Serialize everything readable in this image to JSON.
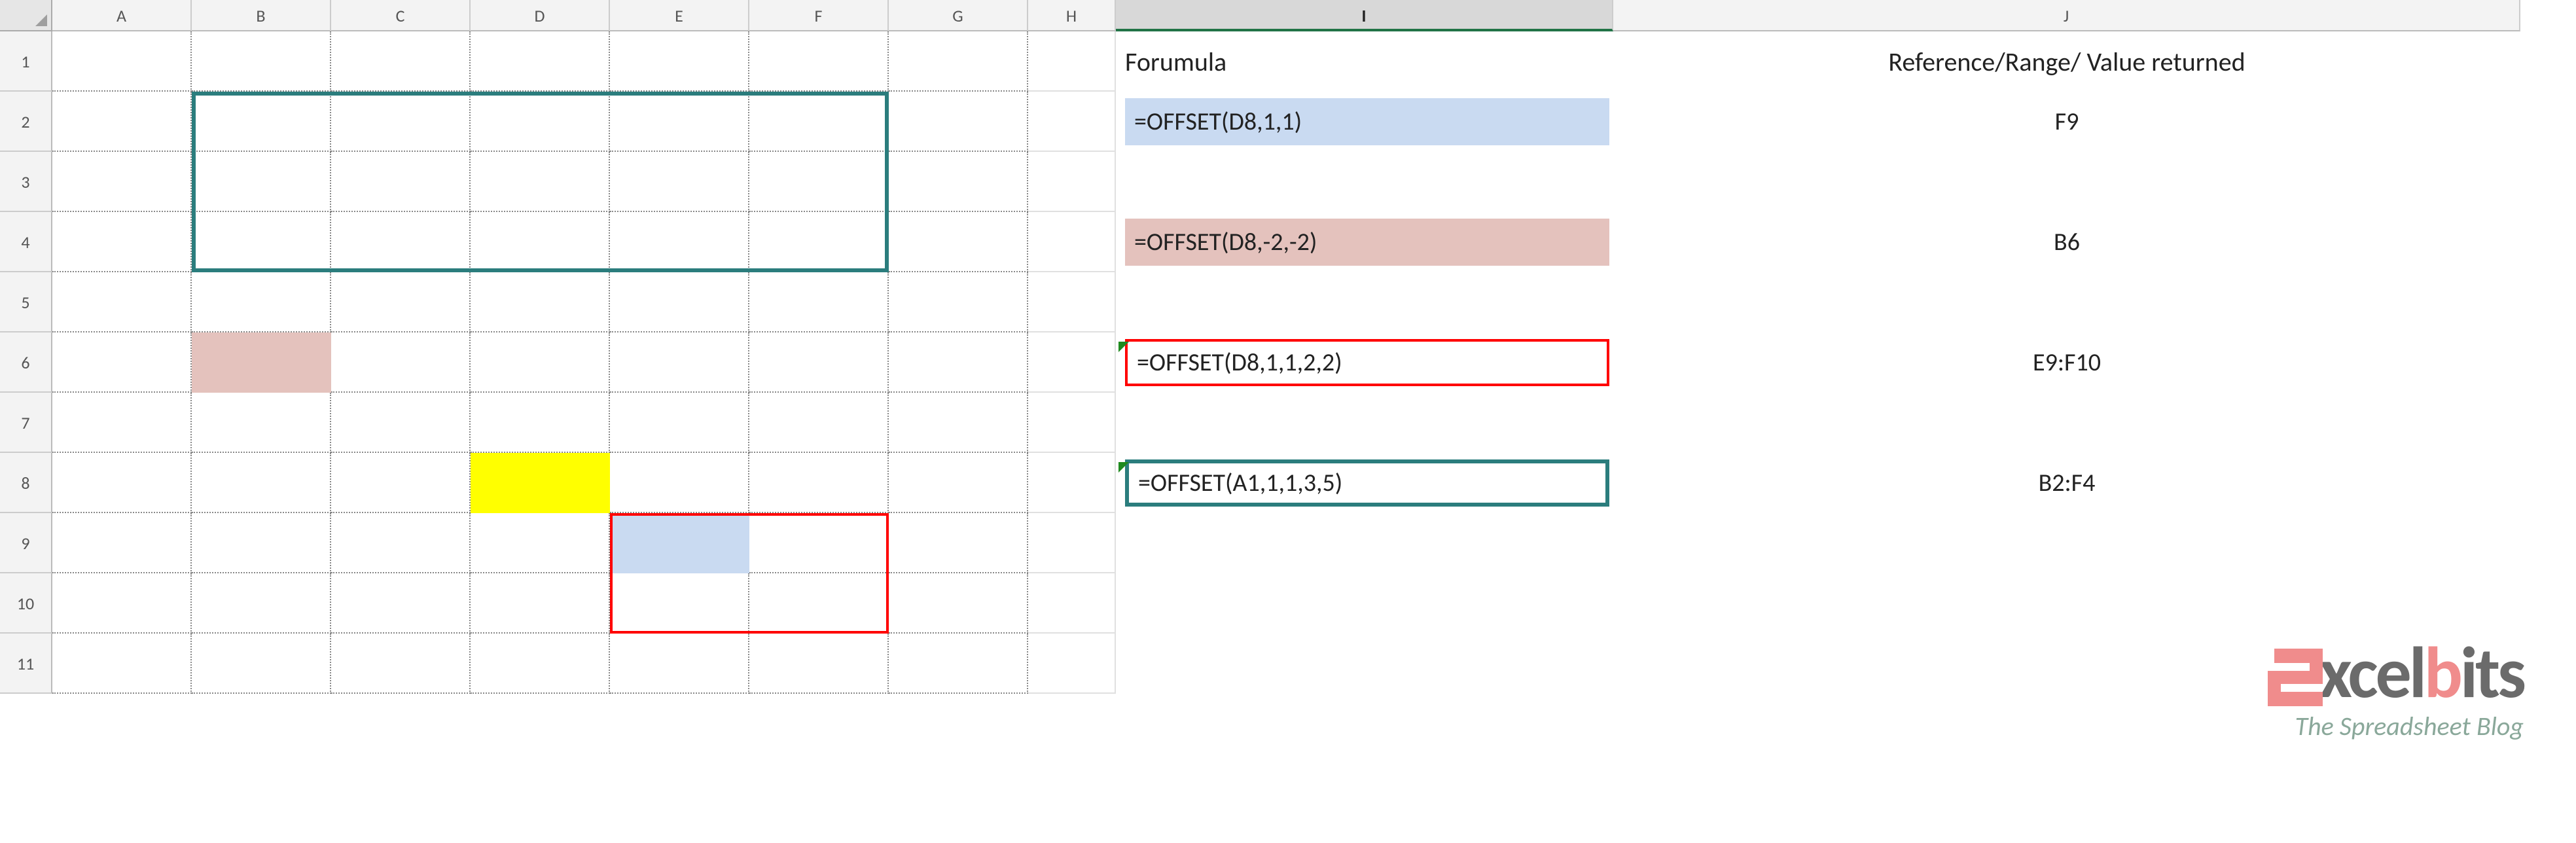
{
  "columns": [
    "A",
    "B",
    "C",
    "D",
    "E",
    "F",
    "G",
    "H",
    "I",
    "J"
  ],
  "row_labels": [
    "1",
    "2",
    "3",
    "4",
    "5",
    "6",
    "7",
    "8",
    "9",
    "10",
    "11"
  ],
  "selected_column": "I",
  "headers": {
    "I": "Forumula",
    "J": "Reference/Range/ Value returned"
  },
  "formulas": [
    {
      "cell": "I2",
      "text": "=OFFSET(D8,1,1)",
      "result_cell": "J2",
      "result": "F9",
      "style": "fill-blue"
    },
    {
      "cell": "I4",
      "text": "=OFFSET(D8,-2,-2)",
      "result_cell": "J4",
      "result": "B6",
      "style": "fill-pink"
    },
    {
      "cell": "I6",
      "text": "=OFFSET(D8,1,1,2,2)",
      "result_cell": "J6",
      "result": "E9:F10",
      "style": "box-red",
      "marker": true
    },
    {
      "cell": "I8",
      "text": "=OFFSET(A1,1,1,3,5)",
      "result_cell": "J8",
      "result": "B2:F4",
      "style": "box-teal",
      "marker": true
    }
  ],
  "highlights": {
    "yellow_fill": "D8",
    "pink_fill": "B6",
    "blue_fill": "E9",
    "teal_outline": "B2:F4",
    "red_outline": "E9:F10"
  },
  "logo": {
    "name": "Excelbits",
    "tagline": "The Spreadsheet Blog"
  },
  "colors": {
    "teal": "#2b7d7d",
    "red": "#ff0000",
    "blue_fill": "#c9daf1",
    "pink_fill": "#e4c2bd",
    "yellow": "#ffff00",
    "excel_green": "#217346",
    "logo_accent": "#f08c8c"
  }
}
